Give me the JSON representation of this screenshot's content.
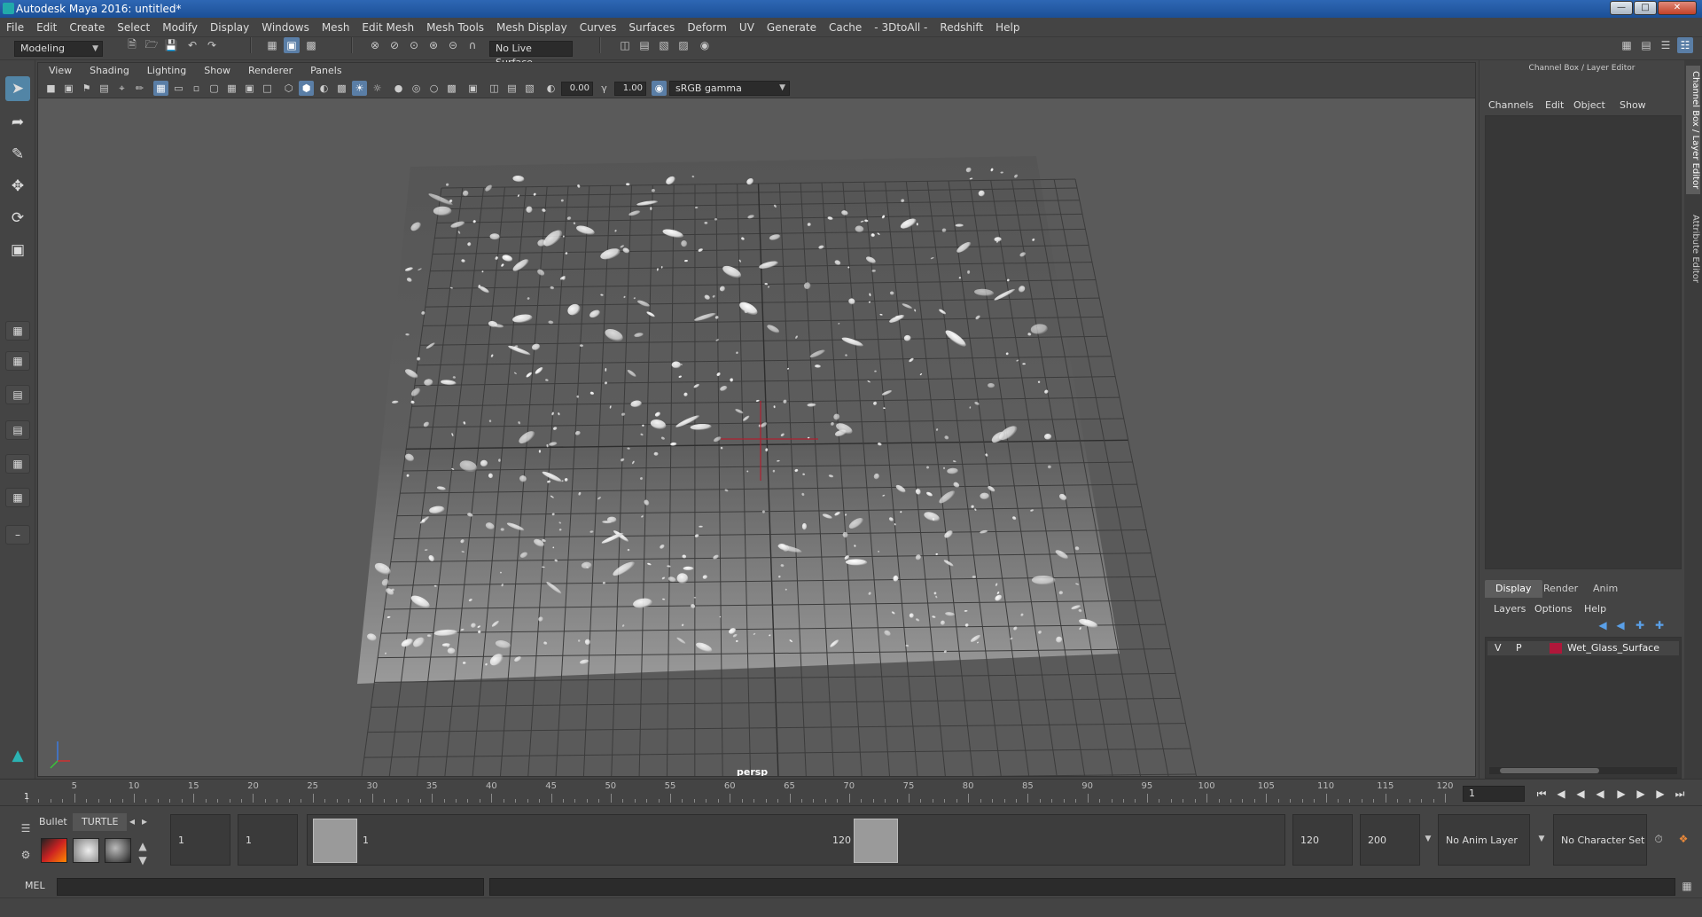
{
  "window": {
    "title": "Autodesk Maya 2016: untitled*"
  },
  "menu": [
    "File",
    "Edit",
    "Create",
    "Select",
    "Modify",
    "Display",
    "Windows",
    "Mesh",
    "Edit Mesh",
    "Mesh Tools",
    "Mesh Display",
    "Curves",
    "Surfaces",
    "Deform",
    "UV",
    "Generate",
    "Cache",
    "- 3DtoAll -",
    "Redshift",
    "Help"
  ],
  "status": {
    "mode": "Modeling",
    "live_surface": "No Live Surface"
  },
  "viewport": {
    "menu": [
      "View",
      "Shading",
      "Lighting",
      "Show",
      "Renderer",
      "Panels"
    ],
    "exposure": "0.00",
    "gamma": "1.00",
    "color_space": "sRGB gamma",
    "camera": "persp",
    "model_name": "Wet_Glass_Surface"
  },
  "channel_box": {
    "title": "Channel Box / Layer Editor",
    "menu": [
      "Channels",
      "Edit",
      "Object",
      "Show"
    ],
    "tabs": [
      "Display",
      "Render",
      "Anim"
    ],
    "layer_menu": [
      "Layers",
      "Options",
      "Help"
    ],
    "layers": [
      {
        "v": "V",
        "p": "P",
        "name": "Wet_Glass_Surface",
        "color": "#b0173a"
      }
    ]
  },
  "side_tabs": [
    "Channel Box / Layer Editor",
    "Attribute Editor"
  ],
  "timeline": {
    "ticks": [
      5,
      10,
      15,
      20,
      25,
      30,
      35,
      40,
      45,
      50,
      55,
      60,
      65,
      70,
      75,
      80,
      85,
      90,
      95,
      100,
      105,
      110,
      115,
      120
    ],
    "start_label": "1",
    "current_frame": "1"
  },
  "range": {
    "shelf_tabs": [
      "Bullet",
      "TURTLE"
    ],
    "start_time": "1",
    "playback_start": "1",
    "range_min_label": "1",
    "range_max_label": "120",
    "playback_end": "120",
    "end_time": "200",
    "anim_layer": "No Anim Layer",
    "character_set": "No Character Set"
  },
  "command_line": {
    "language": "MEL"
  }
}
